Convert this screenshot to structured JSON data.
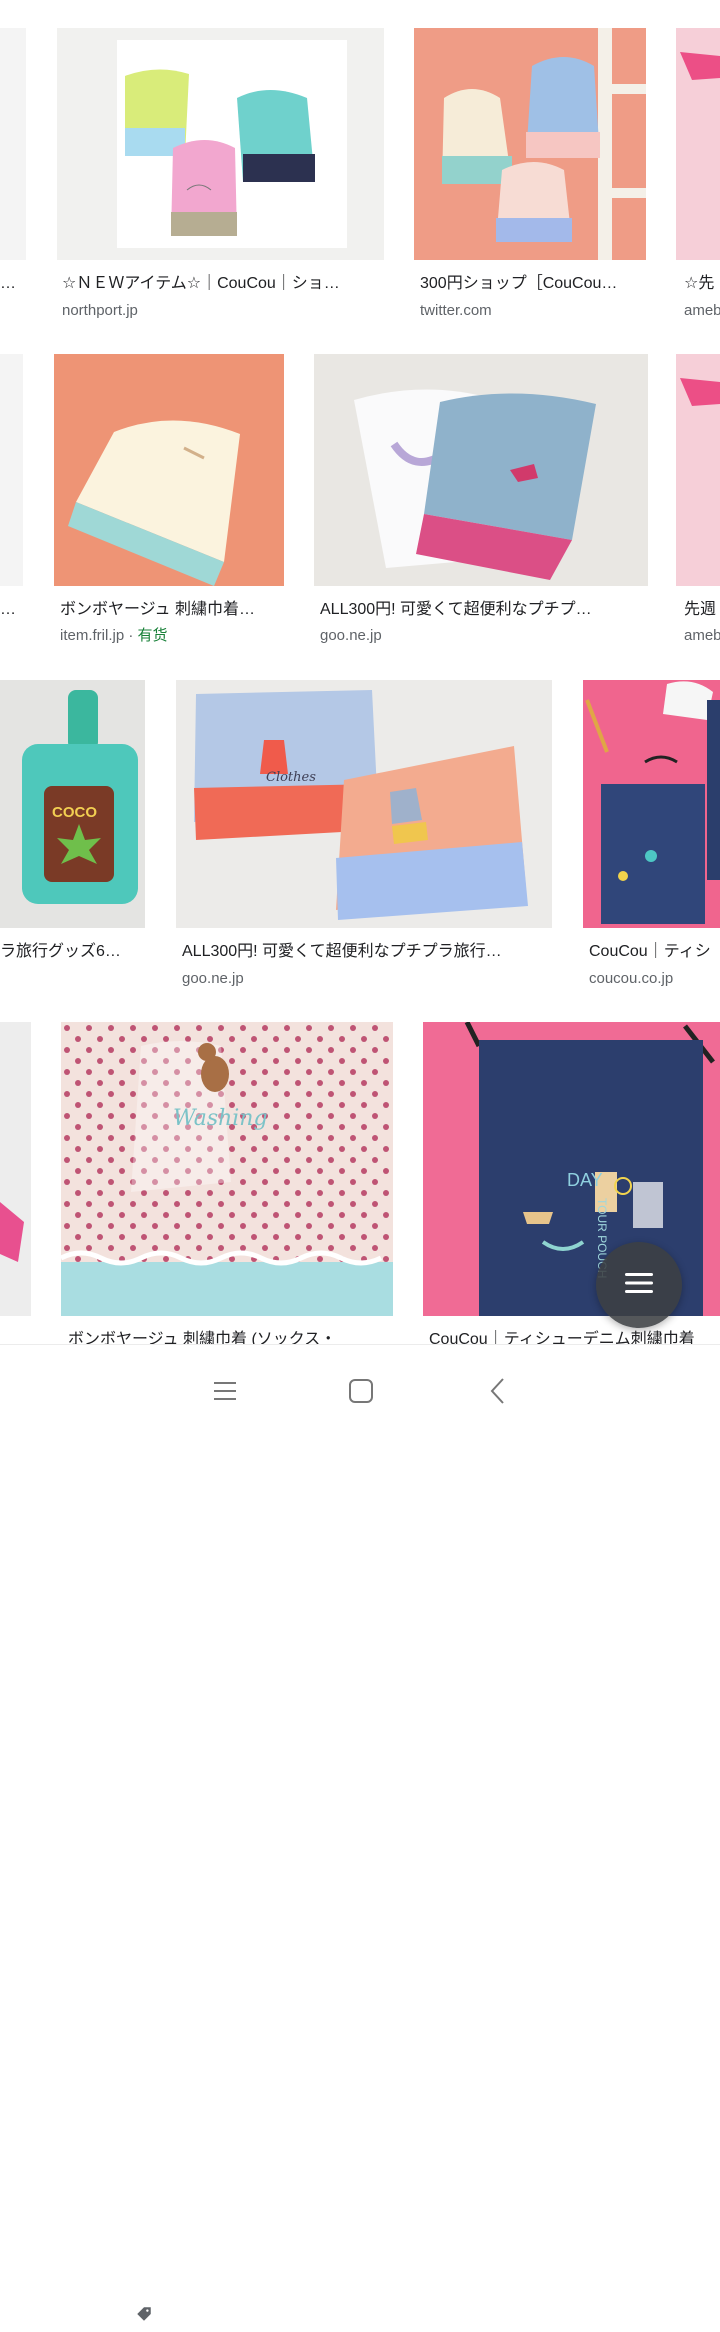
{
  "results": [
    {
      "caption": "…",
      "source": ""
    },
    {
      "caption": "☆ＮＥＷアイテム☆｜CouCou｜ショ…",
      "source": "northport.jp"
    },
    {
      "caption": "300円ショップ［CouCou…",
      "source": "twitter.com"
    },
    {
      "caption": "☆先",
      "source": "ameb"
    },
    {
      "caption": "…",
      "source": ""
    },
    {
      "caption": "ボンボヤージュ 刺繍巾着…",
      "source": "item.fril.jp",
      "badge": "有货"
    },
    {
      "caption": "ALL300円! 可愛くて超便利なプチプ…",
      "source": "goo.ne.jp"
    },
    {
      "caption": "先週",
      "source": "ameb"
    },
    {
      "caption": "ラ旅行グッズ6…",
      "source": ""
    },
    {
      "caption": "ALL300円! 可愛くて超便利なプチプラ旅行…",
      "source": "goo.ne.jp"
    },
    {
      "caption": "CouCou｜ティシ",
      "source": "coucou.co.jp"
    },
    {
      "caption": "ボンボヤージュ 刺繍巾着 (ソックス・",
      "source": ""
    },
    {
      "caption": "CouCou｜ティシューデニム刺繍巾着",
      "source": ""
    }
  ],
  "image_text": {
    "coco": "COCO",
    "clothes": "Clothes",
    "washing": "Washing",
    "day": "DAY",
    "tour": "TOUR POUCH"
  },
  "icons": {
    "tag": "tag-icon",
    "fab": "menu-icon",
    "nav": [
      "recent-apps-icon",
      "home-icon",
      "back-icon"
    ]
  },
  "colors": {
    "caption": "#202124",
    "source": "#5f6368",
    "badge": "#188038",
    "fab": "#3c4043"
  }
}
